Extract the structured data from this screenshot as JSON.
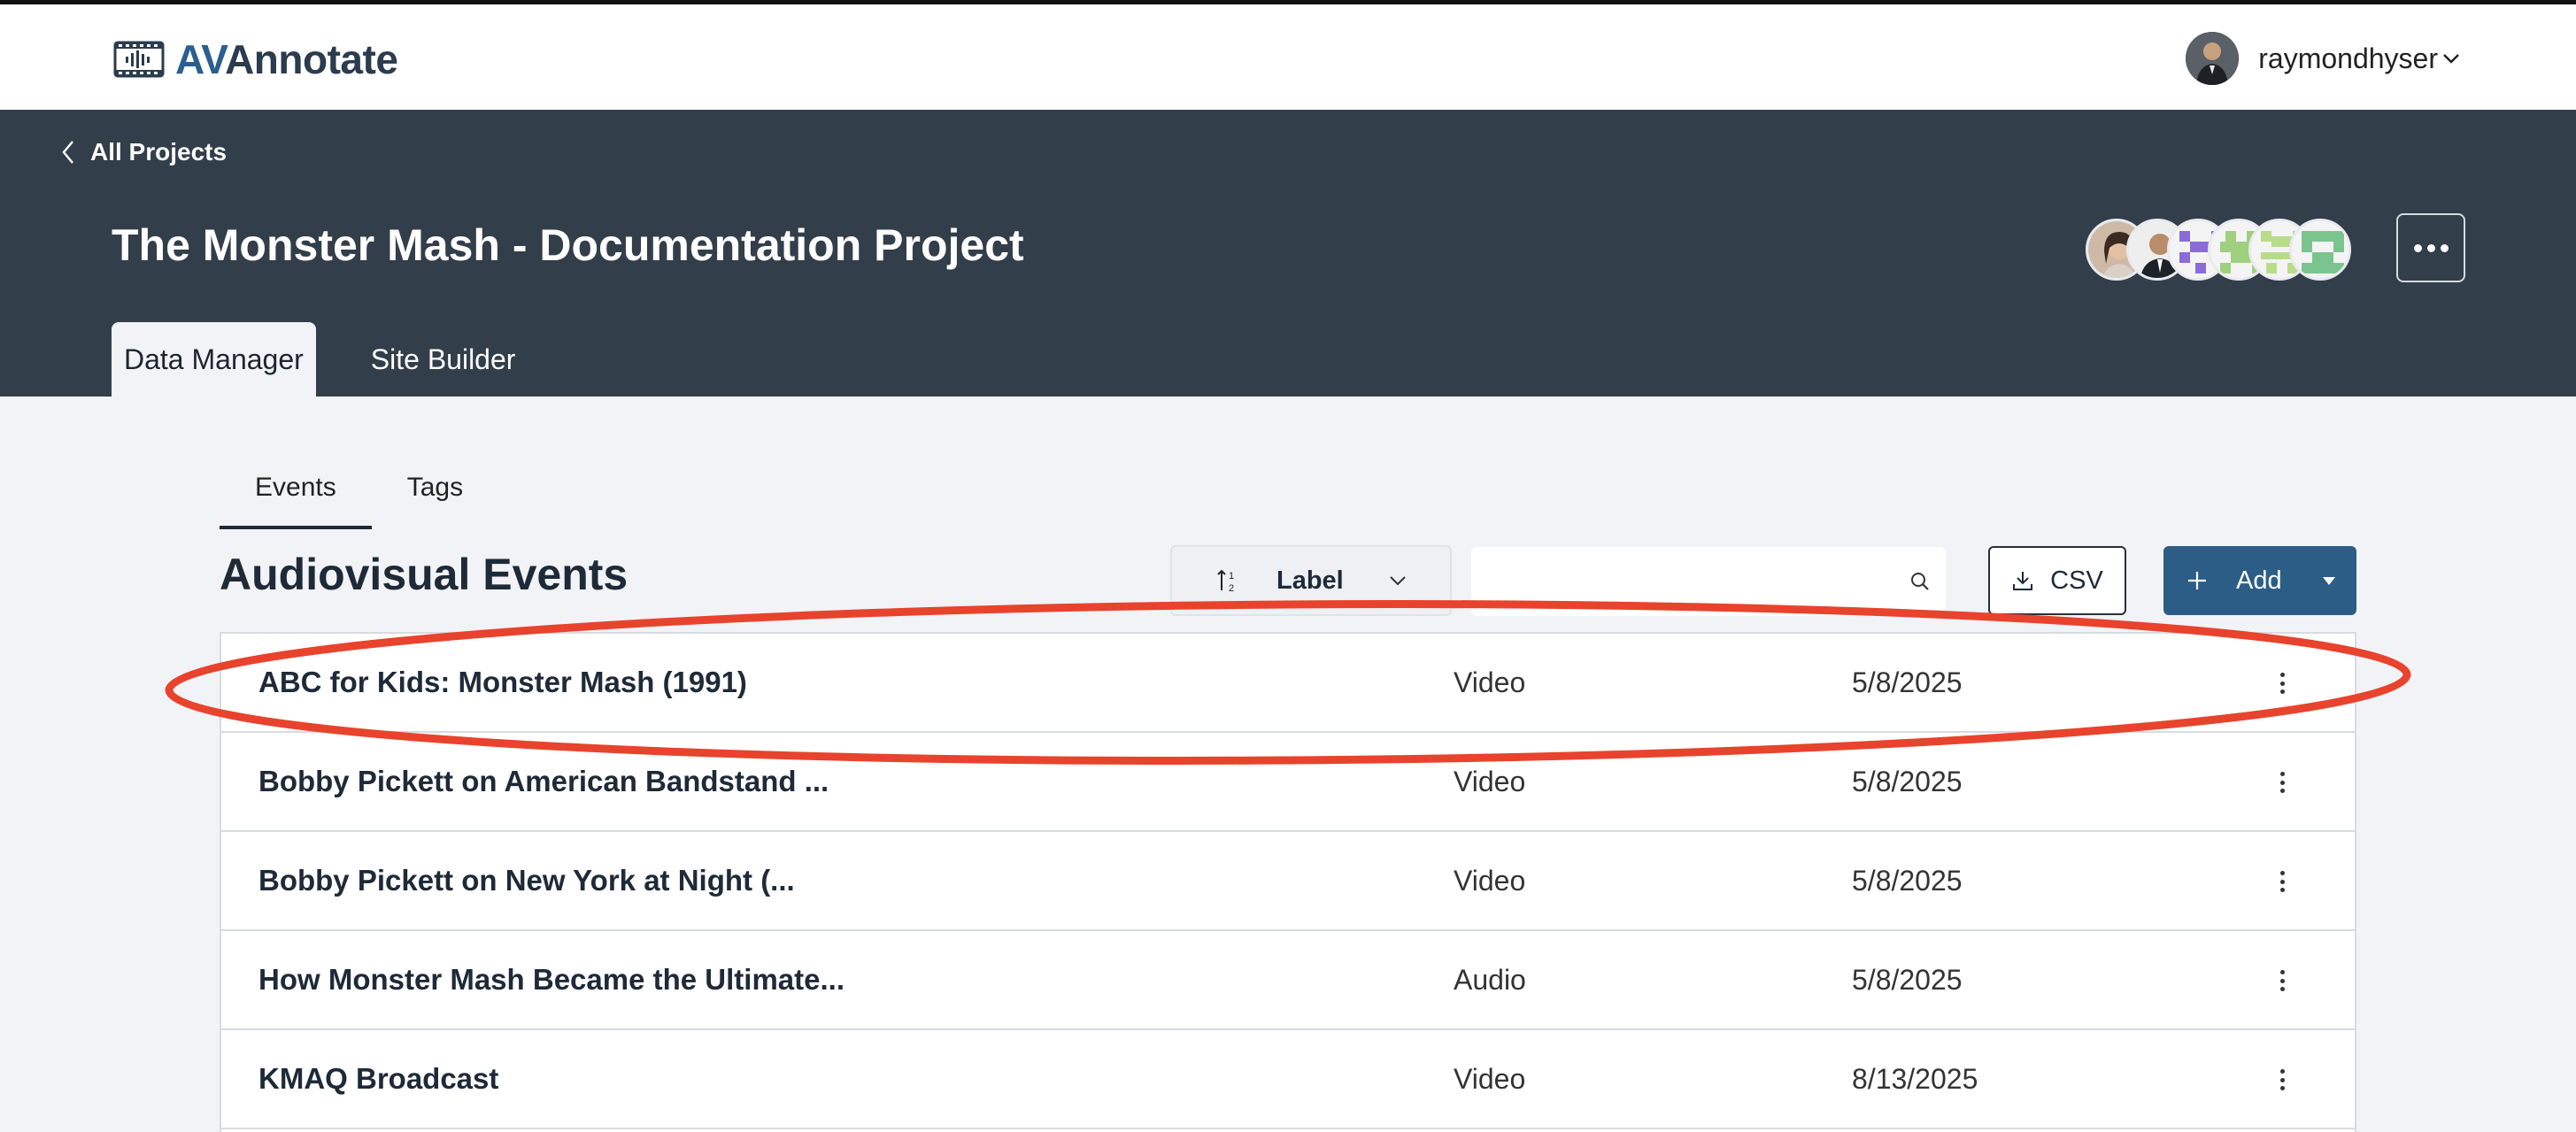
{
  "app": {
    "logo_prefix": "AV",
    "logo_suffix": "Annotate"
  },
  "user": {
    "name": "raymondhyser"
  },
  "header": {
    "back_label": "All Projects",
    "project_title": "The Monster Mash - Documentation Project",
    "tabs": [
      {
        "label": "Data Manager",
        "active": true
      },
      {
        "label": "Site Builder",
        "active": false
      }
    ]
  },
  "subtabs": [
    {
      "label": "Events",
      "active": true
    },
    {
      "label": "Tags",
      "active": false
    }
  ],
  "section_title": "Audiovisual Events",
  "toolbar": {
    "sort_label": "Label",
    "search_placeholder": "",
    "csv_label": "CSV",
    "add_label": "Add"
  },
  "events": [
    {
      "label": "ABC for Kids: Monster Mash (1991)",
      "type": "Video",
      "date": "5/8/2025"
    },
    {
      "label": "Bobby Pickett on American Bandstand ...",
      "type": "Video",
      "date": "5/8/2025"
    },
    {
      "label": "Bobby Pickett on New York at Night (...",
      "type": "Video",
      "date": "5/8/2025"
    },
    {
      "label": "How Monster Mash Became the Ultimate...",
      "type": "Audio",
      "date": "5/8/2025"
    },
    {
      "label": "KMAQ Broadcast",
      "type": "Video",
      "date": "8/13/2025"
    }
  ],
  "colors": {
    "header_bg": "#323e4a",
    "primary_button": "#2c5d86",
    "highlight_annotation": "#e8432d",
    "page_bg": "#f2f3f7"
  }
}
